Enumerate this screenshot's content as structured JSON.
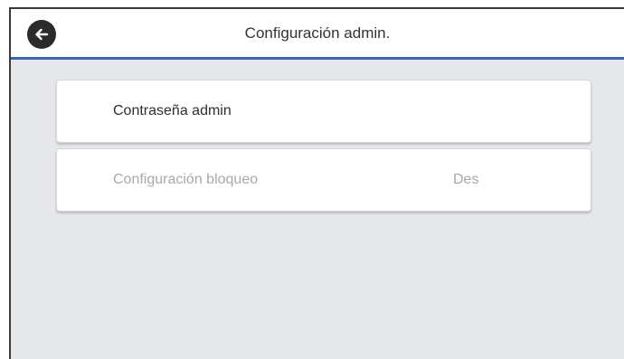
{
  "header": {
    "title": "Configuración admin.",
    "back_icon": "arrow-left-icon",
    "accent_color": "#3f63ad"
  },
  "menu": {
    "items": [
      {
        "label": "Contraseña admin",
        "value": "",
        "enabled": true
      },
      {
        "label": "Configuración bloqueo",
        "value": "Des",
        "enabled": false
      }
    ]
  }
}
